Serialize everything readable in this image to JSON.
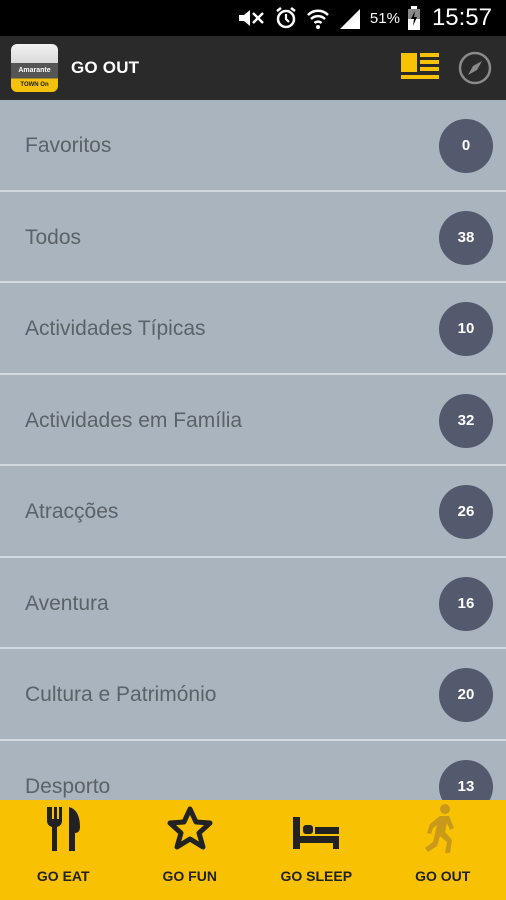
{
  "status_bar": {
    "battery": "51%",
    "time": "15:57",
    "icons": [
      "mute-icon",
      "alarm-icon",
      "wifi-icon",
      "signal-icon",
      "battery-icon"
    ]
  },
  "app_bar": {
    "title": "GO OUT",
    "logo": {
      "text": "Amarante",
      "tag": "TOWN On"
    },
    "actions": [
      "list-view-icon",
      "compass-icon"
    ],
    "accent_color": "#f8c102"
  },
  "categories": [
    {
      "label": "Favoritos",
      "count": "0"
    },
    {
      "label": "Todos",
      "count": "38"
    },
    {
      "label": "Actividades Típicas",
      "count": "10"
    },
    {
      "label": "Actividades em Família",
      "count": "32"
    },
    {
      "label": "Atracções",
      "count": "26"
    },
    {
      "label": "Aventura",
      "count": "16"
    },
    {
      "label": "Cultura e Património",
      "count": "20"
    },
    {
      "label": "Desporto",
      "count": "13"
    }
  ],
  "bottom_nav": [
    {
      "label": "GO EAT",
      "icon": "fork-knife-icon",
      "active": false
    },
    {
      "label": "GO FUN",
      "icon": "star-icon",
      "active": false
    },
    {
      "label": "GO SLEEP",
      "icon": "bed-icon",
      "active": false
    },
    {
      "label": "GO OUT",
      "icon": "walking-person-icon",
      "active": true
    }
  ],
  "colors": {
    "list_background": "#a9b4bf",
    "count_badge": "#535a6e",
    "bottom_nav": "#f8c102",
    "app_bar": "#2a2a2a"
  }
}
